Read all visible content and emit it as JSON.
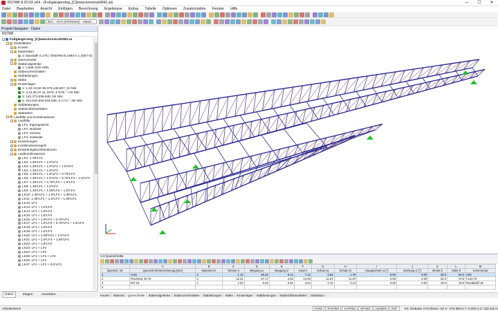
{
  "title": "RSTAB 8.20.02.x64 - [Fußgängersteg_[C]www.konstruktING.at]",
  "menu": [
    "Datei",
    "Bearbeiten",
    "Ansicht",
    "Einfügen",
    "Berechnung",
    "Ergebnisse",
    "Extras",
    "Tabelle",
    "Optionen",
    "Zusatzmodule",
    "Fenster",
    "Hilfe"
  ],
  "toolbar": {
    "loadcase": "EK1 - G2T (STR/GEO) - Ständ...",
    "zoom": ""
  },
  "navigator": {
    "header": "Projekt-Navigator - Daten",
    "root": "RSTAB",
    "tree": [
      {
        "level": 0,
        "exp": "-",
        "text": "Fußgängersteg_[C]www.konstruktING.at",
        "bold": true,
        "c": "#3a6fb0"
      },
      {
        "level": 1,
        "exp": "-",
        "text": "Modelldaten",
        "c": "#d9a640"
      },
      {
        "level": 2,
        "exp": "+",
        "text": "Knoten",
        "c": "#d9a640"
      },
      {
        "level": 2,
        "exp": "-",
        "text": "Materialien",
        "c": "#d9a640"
      },
      {
        "level": 3,
        "exp": "",
        "text": "2: Baustahl S 275 | ÖNORM B 1993-1-1:2007-02",
        "c": "#a0a0a0"
      },
      {
        "level": 2,
        "exp": "+",
        "text": "Querschnitte",
        "c": "#d9a640"
      },
      {
        "level": 2,
        "exp": "-",
        "text": "Stabendgelenke",
        "c": "#d9a640"
      },
      {
        "level": 3,
        "exp": "",
        "text": "1: Lokal; |NN NNN",
        "c": "#777"
      },
      {
        "level": 2,
        "exp": "",
        "text": "Stabexzentrizitäten",
        "c": "#d9a640"
      },
      {
        "level": 2,
        "exp": "",
        "text": "Stabteilungen",
        "c": "#d9a640"
      },
      {
        "level": 2,
        "exp": "+",
        "text": "Stäbe",
        "c": "#d9a640"
      },
      {
        "level": 2,
        "exp": "-",
        "text": "Knotenlager",
        "c": "#d9a640"
      },
      {
        "level": 3,
        "exp": "",
        "text": "1: 1,32-34,50-38,375,448,837; |U NNI",
        "c": "#2a8a2a"
      },
      {
        "level": 3,
        "exp": "",
        "text": "2: 3,13,36,37,41,1675; Z 8.05 °; NII NNI",
        "c": "#2a8a2a"
      },
      {
        "level": 3,
        "exp": "",
        "text": "3: 122,373,839-845; NII NNI",
        "c": "#2a8a2a"
      },
      {
        "level": 3,
        "exp": "",
        "text": "4: 423,510,832-834,838; Z 17.0 °; NII NNI",
        "c": "#2a8a2a"
      },
      {
        "level": 2,
        "exp": "",
        "text": "Stabbettungen",
        "c": "#d9a640"
      },
      {
        "level": 2,
        "exp": "",
        "text": "Stabnichtlinearitäten",
        "c": "#d9a640"
      },
      {
        "level": 2,
        "exp": "",
        "text": "Stabsätze",
        "c": "#d9a640"
      },
      {
        "level": 1,
        "exp": "-",
        "text": "Lastfälle und Kombinationen",
        "c": "#d9a640"
      },
      {
        "level": 2,
        "exp": "-",
        "text": "Lastfälle",
        "c": "#d9a640"
      },
      {
        "level": 3,
        "exp": "",
        "text": "LF1: Eigengewicht",
        "c": "#999"
      },
      {
        "level": 3,
        "exp": "",
        "text": "LF2: Nutzlast",
        "c": "#999"
      },
      {
        "level": 3,
        "exp": "",
        "text": "LF3: Schnee",
        "c": "#999"
      },
      {
        "level": 3,
        "exp": "",
        "text": "LF4: Geländer",
        "c": "#999"
      },
      {
        "level": 2,
        "exp": "+",
        "text": "Einwirkungen",
        "c": "#d9a640"
      },
      {
        "level": 2,
        "exp": "+",
        "text": "Kombinationsregeln",
        "c": "#d9a640"
      },
      {
        "level": 2,
        "exp": "+",
        "text": "Einwirkungskombinationen",
        "c": "#d9a640"
      },
      {
        "level": 2,
        "exp": "-",
        "text": "Lastkombinationen",
        "c": "#d9a640"
      },
      {
        "level": 3,
        "exp": "",
        "text": "LK1: 1.35*LF1",
        "c": "#999"
      },
      {
        "level": 3,
        "exp": "",
        "text": "LK2: 1.35*LF1 + 1.5*LF2",
        "c": "#999"
      },
      {
        "level": 3,
        "exp": "",
        "text": "LK3: 1.35*LF1 + 1.5*LF2 + 1.5*LF4",
        "c": "#999"
      },
      {
        "level": 3,
        "exp": "",
        "text": "LK4: 1.35*LF1 + 1.5*LF3",
        "c": "#999"
      },
      {
        "level": 3,
        "exp": "",
        "text": "LK5: 1.35*LF1 + 1.5*LF2 + 0.75*LF3",
        "c": "#999"
      },
      {
        "level": 3,
        "exp": "",
        "text": "LK6: 1.35*LF1 + 1.5*LF2 + 0.75*LF3 + 1.5*LF4",
        "c": "#999"
      },
      {
        "level": 3,
        "exp": "",
        "text": "LK7: 1.35*LF1 + 0.75*LF2 + 1.5*LF3",
        "c": "#999"
      },
      {
        "level": 3,
        "exp": "",
        "text": "LK8: 1.35*LF1 + 1.5*LF4",
        "c": "#999"
      },
      {
        "level": 3,
        "exp": "",
        "text": "LK9: 1.35*LF1 + 1.05*LF2 + 1.5*LF4",
        "c": "#999"
      },
      {
        "level": 3,
        "exp": "",
        "text": "LK10: 1.35*LF1 + 1.5*LF3 + 1.05*LF4",
        "c": "#999"
      },
      {
        "level": 3,
        "exp": "",
        "text": "LK11: 1.35*LF1 + 1.5*LF3 + 1.05*LF4",
        "c": "#999"
      },
      {
        "level": 3,
        "exp": "",
        "text": "LK12: LF1",
        "c": "#999"
      },
      {
        "level": 3,
        "exp": "",
        "text": "LK13: LF1 + 1.5*LF2",
        "c": "#999"
      },
      {
        "level": 3,
        "exp": "",
        "text": "LK14: LF1 + 1.5*LF4",
        "c": "#999"
      },
      {
        "level": 3,
        "exp": "",
        "text": "LK15: LF1 + 1.5*LF4",
        "c": "#999"
      },
      {
        "level": 3,
        "exp": "",
        "text": "LK16: LF1 + 1.5*LF2 + 0.75*LF3",
        "c": "#999"
      },
      {
        "level": 3,
        "exp": "",
        "text": "LK17: LF1 + 1.5*LF2 + 0.75*LF3 + 1.5*LF4",
        "c": "#999"
      },
      {
        "level": 3,
        "exp": "",
        "text": "LK18: LF1 + 1.5*LF3",
        "c": "#999"
      },
      {
        "level": 3,
        "exp": "",
        "text": "LK19: LF1 + 1.5*LF3",
        "c": "#999"
      },
      {
        "level": 3,
        "exp": "",
        "text": "LK20: LF1 + 1.05*LF2 + 1.5*LF3",
        "c": "#999"
      },
      {
        "level": 3,
        "exp": "",
        "text": "LK21: LF1 + 1.5*LF3 + 1.05*LF4",
        "c": "#999"
      },
      {
        "level": 3,
        "exp": "",
        "text": "LK22: LF1 + 1.5*LF4",
        "c": "#999"
      },
      {
        "level": 3,
        "exp": "",
        "text": "LK23: LF1 + LF2",
        "c": "#999"
      },
      {
        "level": 3,
        "exp": "",
        "text": "LK24: LF1 + LF2",
        "c": "#999"
      },
      {
        "level": 3,
        "exp": "",
        "text": "LK25: LF1 + LF2 + LF4",
        "c": "#999"
      },
      {
        "level": 3,
        "exp": "",
        "text": "LK26: LF1 + LF4",
        "c": "#999"
      },
      {
        "level": 3,
        "exp": "",
        "text": "LK27: LF1 + LF2 + 0.5*LF3",
        "c": "#999"
      }
    ],
    "tabs": [
      "Daten",
      "Zeigen",
      "Ansichten"
    ]
  },
  "table": {
    "caption": "1.3 Querschnitte",
    "group_headers": [
      "A",
      "B",
      "C",
      "D",
      "E",
      "F",
      "G",
      "H",
      "I",
      "J",
      "K",
      "L",
      "M"
    ],
    "headers": [
      "Quersch. Nr.",
      "Querschnitt Bezeichnung [mm]",
      "Material Nr.",
      "Torsion It",
      "Biegung Iy",
      "Biegung Iz",
      "Axial A",
      "Schub Ay",
      "Schub Az",
      "Hauptachsen α [°]",
      "Drehung α' [°]",
      "Breite b",
      "Höhe h",
      "Kommentar"
    ],
    "rows": [
      [
        "1",
        "U 50",
        "2",
        "1.12",
        "26.40",
        "9.12",
        "7.12",
        "3.54",
        "1.75",
        "0.00",
        "0.00",
        "38.0",
        "50.0",
        "U50"
      ],
      [
        "2",
        "Flachstck 20.75",
        "2",
        "15.31",
        "57.17",
        "4.82",
        "14.00",
        "11.67",
        "11.67",
        "0.00",
        "0.00",
        "20.0",
        "70.0",
        "FL20.70"
      ],
      [
        "3",
        "RO 18",
        "2",
        "1.03",
        "0.52",
        "0.52",
        "2.54",
        "2.13",
        "2.13",
        "0.00",
        "0.00",
        "18.0",
        "18.0",
        "Rundstahl 18"
      ],
      [
        "4",
        "",
        "",
        "",
        "",
        "",
        "",
        "",
        "",
        "",
        "",
        "",
        "",
        ""
      ]
    ],
    "sheet_tabs": [
      "Knoten",
      "Material",
      "Querschnitte",
      "Stabendgelenke",
      "Stabexzentrizitäten",
      "Stabteilungen",
      "Stäbe",
      "Knotenlager",
      "Stabbettungen",
      "Stabnichtlinearitäten",
      "Stabsätze"
    ]
  },
  "status": {
    "left": "Arbeitsebene",
    "buttons": [
      "FANG",
      "RASTER",
      "KARTES",
      "OFANG",
      "HLINIEN",
      "DXF"
    ],
    "coords": "KS: Globales XYZ Ebene: XZ   X: -474.559 m  Y: 0.000 m  Z: 333.215 m"
  },
  "colors": {
    "member": "#2d2d8f",
    "brace": "#7a2040",
    "support": "#22c02a",
    "accent": "#3a6fb0"
  }
}
